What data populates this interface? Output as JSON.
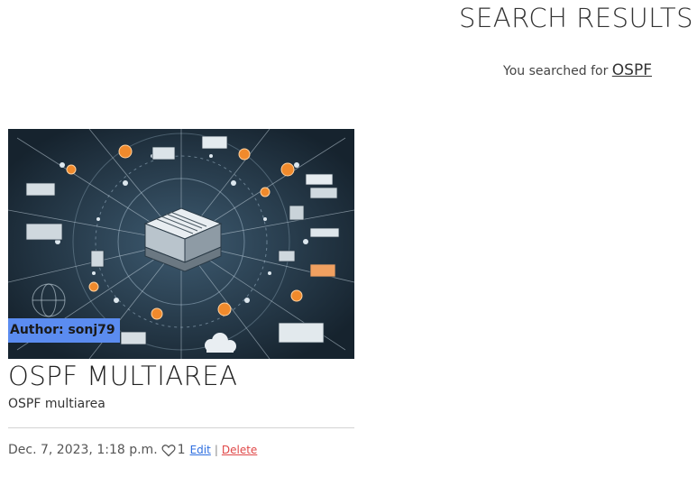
{
  "header": {
    "title": "SEARCH RESULTS",
    "search_prefix": "You searched for",
    "search_term": "OSPF"
  },
  "results": [
    {
      "author_label": "Author: sonj79",
      "title": "OSPF MULTIAREA",
      "excerpt": "OSPF multiarea",
      "date": "Dec. 7, 2023, 1:18 p.m.",
      "likes": "1",
      "edit_label": "Edit",
      "separator": "|",
      "delete_label": "Delete"
    }
  ],
  "icons": {
    "like": "heart-outline-icon"
  },
  "colors": {
    "author_badge": "#5b8cf0",
    "edit_link": "#2f6fe0",
    "delete_link": "#e04848",
    "image_background": "#1d2f3d"
  }
}
